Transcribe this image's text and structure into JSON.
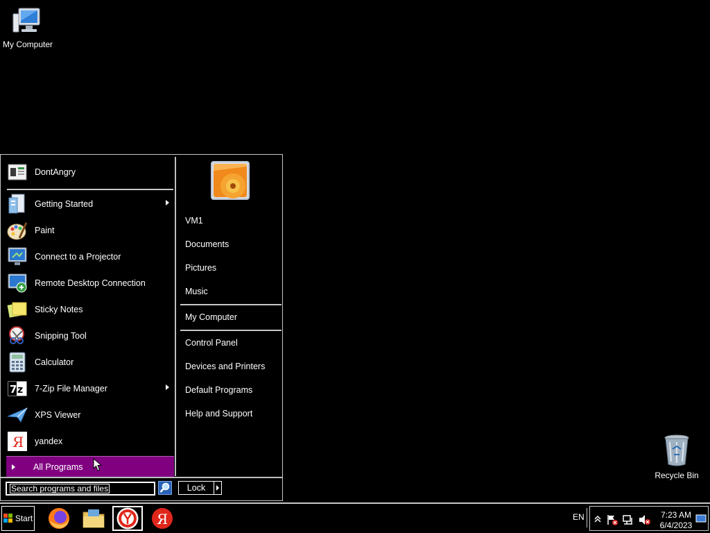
{
  "desktop": {
    "icons": [
      {
        "label": "My Computer",
        "icon": "computer-icon"
      },
      {
        "label": "Recycle Bin",
        "icon": "recycle-bin-icon"
      }
    ]
  },
  "start_menu": {
    "pinned": {
      "label": "DontAngry",
      "icon": "dontangry-icon"
    },
    "programs": [
      {
        "label": "Getting Started",
        "icon": "getting-started-icon",
        "submenu": true
      },
      {
        "label": "Paint",
        "icon": "paint-icon",
        "submenu": false
      },
      {
        "label": "Connect to a Projector",
        "icon": "projector-icon",
        "submenu": false
      },
      {
        "label": "Remote Desktop Connection",
        "icon": "remote-desktop-icon",
        "submenu": false
      },
      {
        "label": "Sticky Notes",
        "icon": "sticky-notes-icon",
        "submenu": false
      },
      {
        "label": "Snipping Tool",
        "icon": "snipping-tool-icon",
        "submenu": false
      },
      {
        "label": "Calculator",
        "icon": "calculator-icon",
        "submenu": false
      },
      {
        "label": "7-Zip File Manager",
        "icon": "7zip-icon",
        "submenu": true
      },
      {
        "label": "XPS Viewer",
        "icon": "xps-viewer-icon",
        "submenu": false
      },
      {
        "label": "yandex",
        "icon": "yandex-icon",
        "submenu": false
      }
    ],
    "all_programs": "All Programs",
    "right": {
      "group1": [
        "VM1",
        "Documents",
        "Pictures",
        "Music"
      ],
      "group2": [
        "My Computer"
      ],
      "group3": [
        "Control Panel",
        "Devices and Printers",
        "Default Programs",
        "Help and Support"
      ]
    },
    "search": {
      "placeholder": "Search programs and files"
    },
    "lock_label": "Lock"
  },
  "taskbar": {
    "start_label": "Start",
    "apps": [
      "firefox-icon",
      "file-explorer-icon",
      "yandex-browser-icon",
      "yandex-icon"
    ],
    "language": "EN",
    "time": "7:23 AM",
    "date": "6/4/2023"
  },
  "colors": {
    "all_programs_bg": "#800080",
    "desktop_bg": "#000000"
  }
}
